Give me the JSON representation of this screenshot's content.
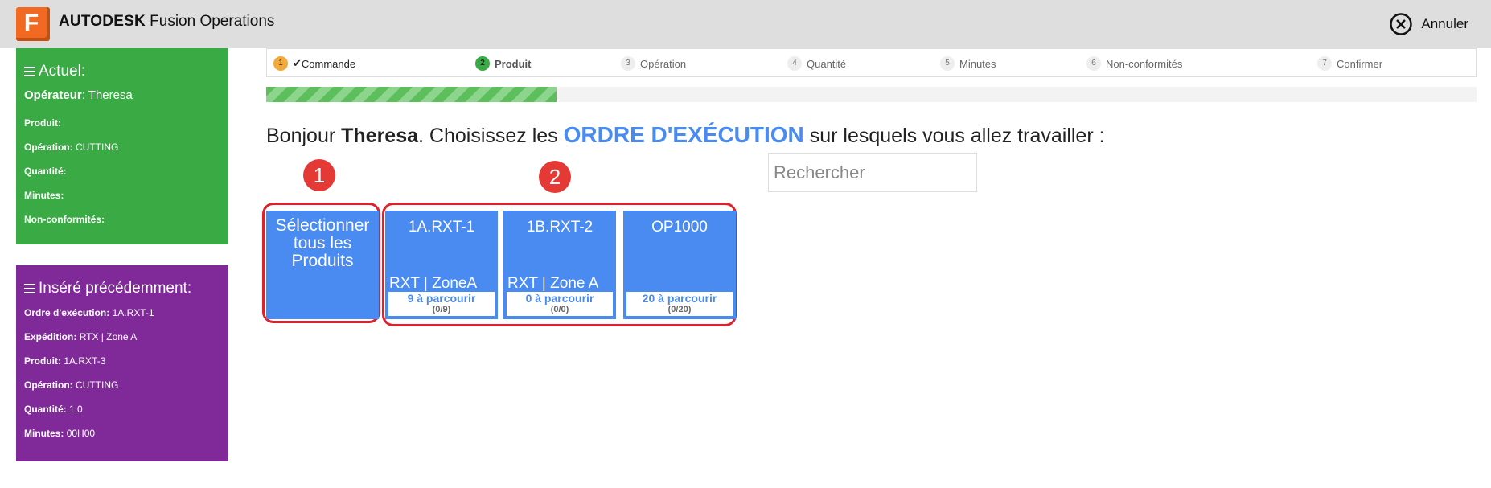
{
  "app": {
    "brand_bold": "AUTODESK",
    "brand_rest": " Fusion Operations",
    "logo_letter": "F",
    "cancel_label": "Annuler"
  },
  "current_panel": {
    "title": "Actuel:",
    "rows": [
      {
        "label": "Opérateur",
        "value": "Theresa"
      },
      {
        "label": "Produit:",
        "value": ""
      },
      {
        "label": "Opération:",
        "value": "CUTTING"
      },
      {
        "label": "Quantité:",
        "value": ""
      },
      {
        "label": "Minutes:",
        "value": ""
      },
      {
        "label": "Non-conformités:",
        "value": ""
      }
    ]
  },
  "previous_panel": {
    "title": "Inséré précédemment:",
    "rows": [
      {
        "label": "Ordre d'exécution:",
        "value": "1A.RXT-1"
      },
      {
        "label": "Expédition:",
        "value": "RTX | Zone A"
      },
      {
        "label": "Produit:",
        "value": "1A.RXT-3"
      },
      {
        "label": "Opération:",
        "value": "CUTTING"
      },
      {
        "label": "Quantité:",
        "value": "1.0"
      },
      {
        "label": "Minutes:",
        "value": "00H00"
      }
    ]
  },
  "steps": [
    {
      "num": "1",
      "check": "✔",
      "label": "Commande",
      "state": "done"
    },
    {
      "num": "2",
      "check": "",
      "label": "Produit",
      "state": "active"
    },
    {
      "num": "3",
      "check": "",
      "label": "Opération",
      "state": "todo"
    },
    {
      "num": "4",
      "check": "",
      "label": "Quantité",
      "state": "todo"
    },
    {
      "num": "5",
      "check": "",
      "label": "Minutes",
      "state": "todo"
    },
    {
      "num": "6",
      "check": "",
      "label": "Non-conformités",
      "state": "todo"
    },
    {
      "num": "7",
      "check": "",
      "label": "Confirmer",
      "state": "todo"
    }
  ],
  "progress": {
    "fraction": 0.24
  },
  "greeting": {
    "hello": "Bonjour ",
    "name": "Theresa",
    "middle": ". Choisissez les ",
    "keyword": "ORDRE D'EXÉCUTION",
    "end": " sur lesquels vous allez travailler :"
  },
  "search": {
    "placeholder": "Rechercher",
    "value": ""
  },
  "annotations": {
    "badge1": "1",
    "badge2": "2"
  },
  "select_all": {
    "label": "Sélectionner tous les Produits"
  },
  "orders": [
    {
      "code": "1A.RXT-1",
      "location": "RXT | ZoneA",
      "todo": "9 à parcourir",
      "ratio": "(0/9)"
    },
    {
      "code": "1B.RXT-2",
      "location": "RXT | Zone A",
      "todo": "0 à parcourir",
      "ratio": "(0/0)"
    },
    {
      "code": "OP1000",
      "location": "",
      "todo": "20 à parcourir",
      "ratio": "(0/20)"
    }
  ],
  "colors": {
    "current_panel": "#3aaa44",
    "previous_panel": "#7f2a98",
    "accent_blue": "#4a8bf1",
    "annotation_red": "#e53935",
    "header_bg": "#dedede"
  }
}
